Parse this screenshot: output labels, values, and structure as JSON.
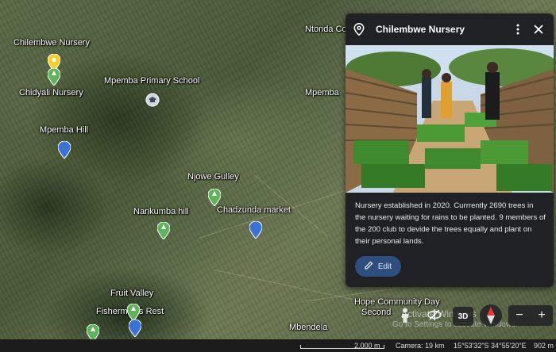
{
  "map": {
    "labels": {
      "ntonda": "Ntonda Co",
      "chilembwe": "Chilembwe Nursery",
      "chidyali": "Chidyali Nursery",
      "mpemba_school": "Mpemba Primary School",
      "mpemba": "Mpemba",
      "mpemba_hill": "Mpemba Hill",
      "njowe": "Njowe Gulley",
      "nankumba": "Nankumba hill",
      "chadzunda": "Chadzunda market",
      "fruit_valley": "Fruit Valley",
      "fishermans": "Fisherman's Rest",
      "hope1": "Hope Community Day",
      "hope2": "Second",
      "mbendela": "Mbendela"
    },
    "colors": {
      "pin_yellow": "#f6cf2f",
      "pin_green": "#5fb35c",
      "pin_blue": "#3a72d8",
      "school_icon": "#cfd6de"
    }
  },
  "card": {
    "title": "Chilembwe Nursery",
    "description": "Nursery established in 2020.  Currrently 2690 trees in the nursery waiting for rains to be planted. 9 members of the 200 club to devide the trees equally and plant on their personal lands.",
    "edit_label": "Edit",
    "icons": [
      "place-icon",
      "more-vert-icon",
      "close-icon",
      "pencil-icon"
    ]
  },
  "controls": {
    "btn_3d": "3D",
    "zoom_out": "−",
    "zoom_in": "+"
  },
  "watermark": {
    "line1": "Activate Windows",
    "line2": "Go to Settings to activate Windows."
  },
  "status": {
    "scale": "2,000 m",
    "camera": "Camera: 19 km",
    "coords": "15°53'32\"S 34°55'20\"E",
    "elevation": "902 m"
  }
}
